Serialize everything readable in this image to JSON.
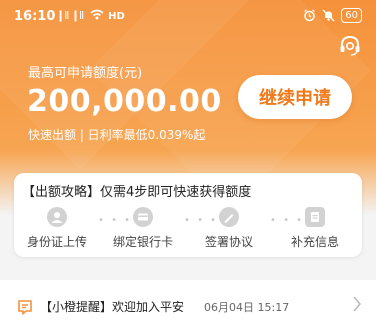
{
  "status_bar": {
    "time": "16:10",
    "network": "❙ll ❙ll",
    "hd": "HD",
    "battery": "60"
  },
  "hero": {
    "label": "最高可申请额度(元)",
    "amount": "200,000.00",
    "subline": "快速出额 | 日利率最低0.039%起",
    "cta_label": "继续申请"
  },
  "steps_card": {
    "title": "【出额攻略】仅需4步即可快速获得额度",
    "steps": [
      {
        "label": "身份证上传",
        "icon": "id-card-icon"
      },
      {
        "label": "绑定银行卡",
        "icon": "bank-card-icon"
      },
      {
        "label": "签署协议",
        "icon": "pen-icon"
      },
      {
        "label": "补充信息",
        "icon": "document-icon"
      }
    ]
  },
  "notice": {
    "text": "【小橙提醒】欢迎加入平安",
    "date": "06月04日 15:17"
  },
  "colors": {
    "brand_orange": "#f5913a",
    "cta_text": "#f07a1c"
  }
}
